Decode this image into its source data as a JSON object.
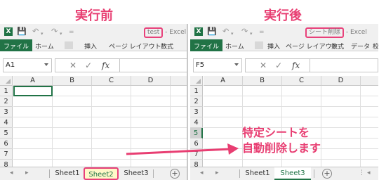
{
  "headings": {
    "before": "実行前",
    "after": "実行後"
  },
  "panes": {
    "left": {
      "doc_name": "test",
      "app_suffix": "- Excel",
      "ribbon_tabs": [
        "ファイル",
        "ホーム",
        "挿入",
        "ページ レイアウト",
        "数式"
      ],
      "name_box": "A1",
      "columns": [
        "A",
        "B",
        "C",
        "D"
      ],
      "rows": [
        "1",
        "2",
        "3",
        "4",
        "5",
        "6",
        "7",
        "8"
      ],
      "sheets": [
        "Sheet1",
        "Sheet2",
        "Sheet3"
      ],
      "active_sheet": "Sheet2"
    },
    "right": {
      "doc_name": "シート削除",
      "app_suffix": "- Excel",
      "ribbon_tabs": [
        "ファイル",
        "ホーム",
        "挿入",
        "ページ レイアウト",
        "数式",
        "データ",
        "校"
      ],
      "name_box": "F5",
      "columns": [
        "A",
        "B",
        "C",
        "D"
      ],
      "rows": [
        "1",
        "2",
        "3",
        "4",
        "5",
        "6",
        "7",
        "8"
      ],
      "sheets": [
        "Sheet1",
        "Sheet3"
      ],
      "active_sheet": "Sheet3",
      "selected_row": "5"
    }
  },
  "formula_bar": {
    "cancel_glyph": "✕",
    "enter_glyph": "✓",
    "fx_label": "fx"
  },
  "sheet_add_glyph": "+",
  "annotation": {
    "line1": "特定シートを",
    "line2": "自動削除します"
  },
  "colors": {
    "accent_pink": "#e83e72",
    "excel_green": "#217346",
    "highlight_yellow": "#fff8c8"
  }
}
